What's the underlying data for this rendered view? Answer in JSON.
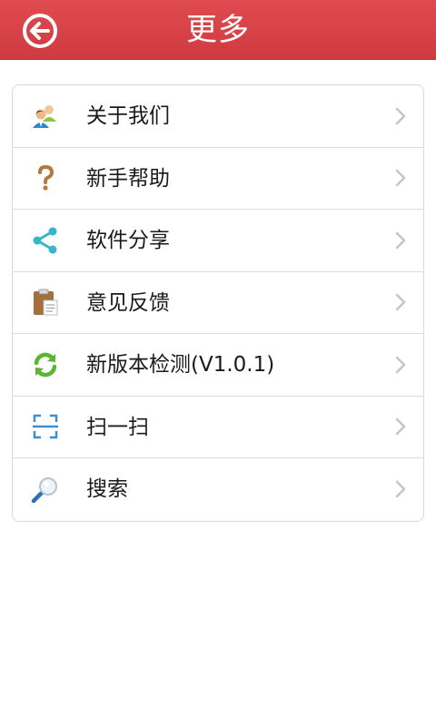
{
  "header": {
    "title": "更多"
  },
  "menu": {
    "items": [
      {
        "label": "关于我们",
        "icon": "users-icon"
      },
      {
        "label": "新手帮助",
        "icon": "question-icon"
      },
      {
        "label": "软件分享",
        "icon": "share-icon"
      },
      {
        "label": "意见反馈",
        "icon": "clipboard-icon"
      },
      {
        "label": "新版本检测(V1.0.1)",
        "icon": "refresh-icon"
      },
      {
        "label": "扫一扫",
        "icon": "scan-icon"
      },
      {
        "label": "搜索",
        "icon": "magnifier-icon"
      }
    ]
  },
  "colors": {
    "header": "#d8434a",
    "accent": "#35b7c7",
    "refresh": "#5cb531"
  }
}
